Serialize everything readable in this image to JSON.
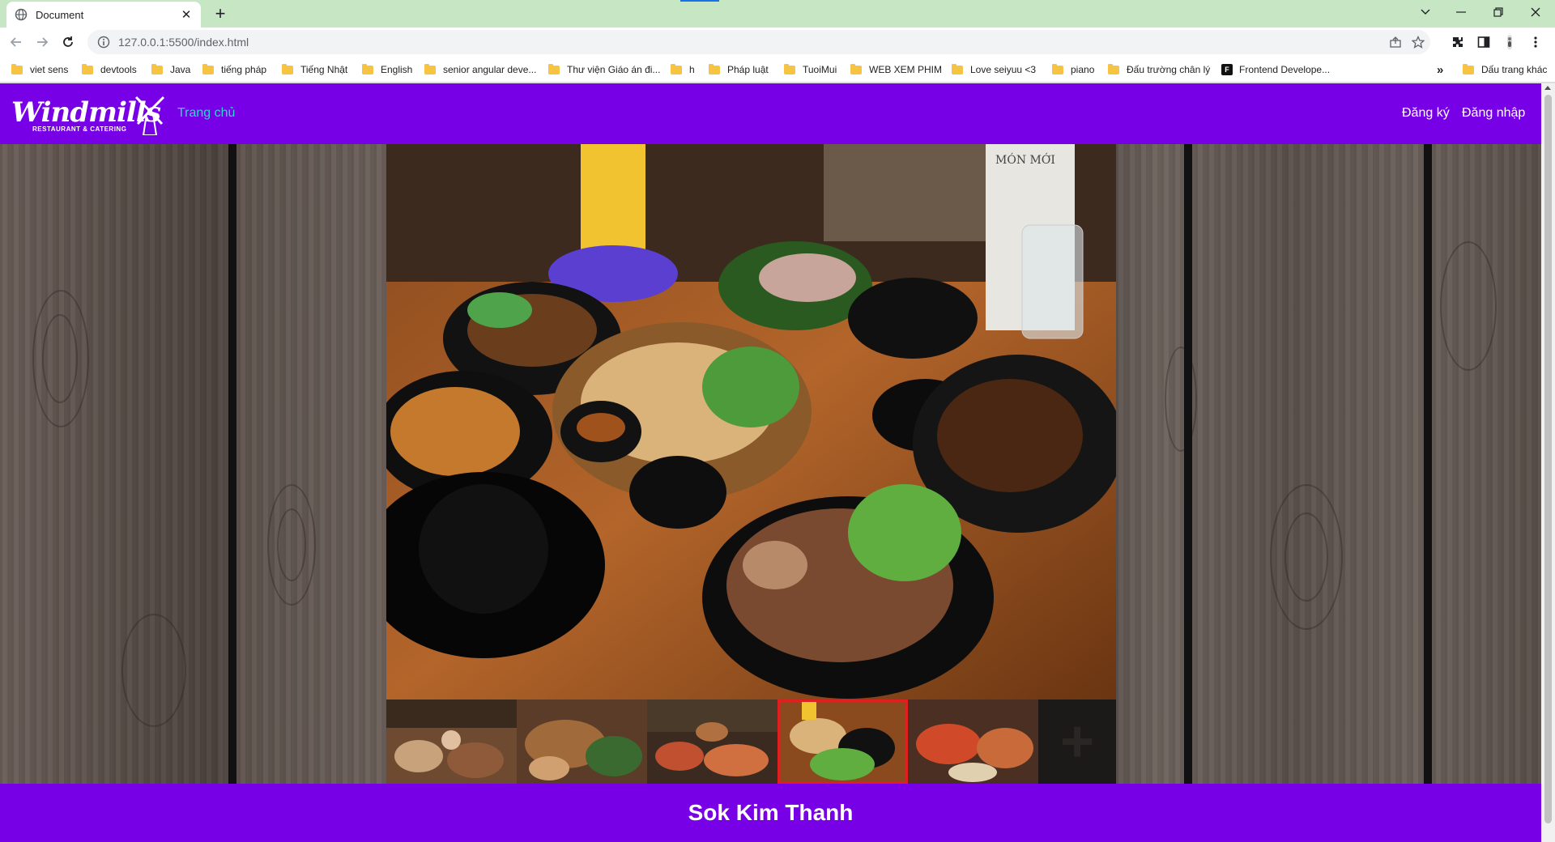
{
  "browser": {
    "tab_title": "Document",
    "url": "127.0.0.1:5500/index.html",
    "bookmarks": [
      "viet sens",
      "devtools",
      "Java",
      "tiếng pháp",
      "Tiếng Nhật",
      "English",
      "senior angular deve...",
      "Thư viện Giáo án đi...",
      "h",
      "Pháp luật",
      "TuoiMui",
      "WEB XEM PHIM",
      "Love seiyuu <3",
      "piano",
      "Đấu trường chân lý",
      "Frontend Develope..."
    ],
    "more_bookmarks": "»",
    "other_bookmarks": "Dấu trang khác"
  },
  "site": {
    "logo_text": "Windmills",
    "logo_sub": "RESTAURANT & CATERING",
    "nav_home": "Trang chủ",
    "nav_register": "Đăng ký",
    "nav_login": "Đăng nhập",
    "gallery_more": "+",
    "footer_text": "Sok Kim Thanh",
    "menu_card": "MÓN MỚI"
  },
  "colors": {
    "brand_purple": "#7700e6",
    "home_link": "#35d4d4",
    "active_thumb_border": "#e02020"
  }
}
